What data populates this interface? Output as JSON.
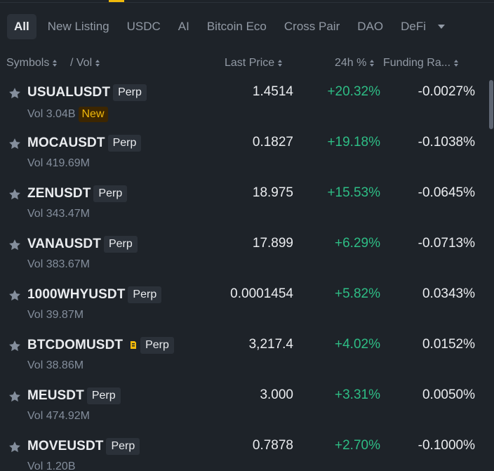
{
  "tabs": [
    "All",
    "New Listing",
    "USDC",
    "AI",
    "Bitcoin Eco",
    "Cross Pair",
    "DAO",
    "DeFi"
  ],
  "active_tab": "All",
  "header": {
    "symbols": "Symbols",
    "vol": "/ Vol",
    "last_price": "Last Price",
    "change": "24h %",
    "funding": "Funding Ra..."
  },
  "rows": [
    {
      "symbol": "USUALUSDT",
      "badge": "Perp",
      "vol": "Vol 3.04B",
      "tag": "New",
      "price": "1.4514",
      "change": "+20.32%",
      "funding": "-0.0027%"
    },
    {
      "symbol": "MOCAUSDT",
      "badge": "Perp",
      "vol": "Vol 419.69M",
      "price": "0.1827",
      "change": "+19.18%",
      "funding": "-0.1038%"
    },
    {
      "symbol": "ZENUSDT",
      "badge": "Perp",
      "vol": "Vol 343.47M",
      "price": "18.975",
      "change": "+15.53%",
      "funding": "-0.0645%"
    },
    {
      "symbol": "VANAUSDT",
      "badge": "Perp",
      "vol": "Vol 383.67M",
      "price": "17.899",
      "change": "+6.29%",
      "funding": "-0.0713%"
    },
    {
      "symbol": "1000WHYUSDT",
      "badge": "Perp",
      "vol": "Vol 39.87M",
      "price": "0.0001454",
      "change": "+5.82%",
      "funding": "0.0343%"
    },
    {
      "symbol": "BTCDOMUSDT",
      "badge": "Perp",
      "vol": "Vol 38.86M",
      "price": "3,217.4",
      "change": "+4.02%",
      "funding": "0.0152%",
      "icon": "bell-icon"
    },
    {
      "symbol": "MEUSDT",
      "badge": "Perp",
      "vol": "Vol 474.92M",
      "price": "3.000",
      "change": "+3.31%",
      "funding": "0.0050%"
    },
    {
      "symbol": "MOVEUSDT",
      "badge": "Perp",
      "vol": "Vol 1.20B",
      "price": "0.7878",
      "change": "+2.70%",
      "funding": "-0.1000%"
    }
  ],
  "colors": {
    "background": "#1e2329",
    "accent": "#f0b90b",
    "positive": "#2ebd85",
    "text_primary": "#eaecef",
    "text_secondary": "#848e9c"
  }
}
